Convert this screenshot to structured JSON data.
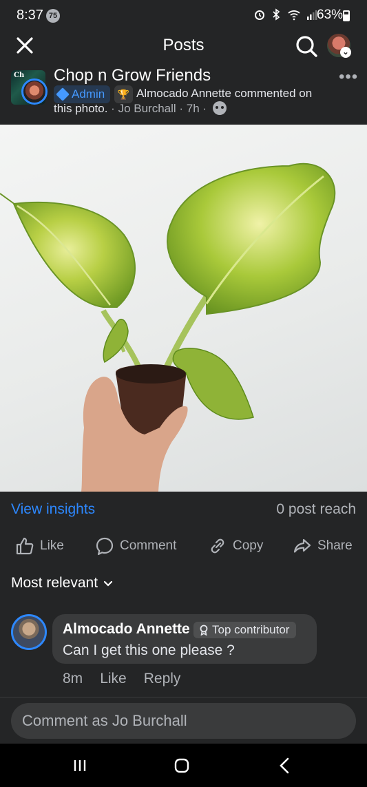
{
  "status_bar": {
    "time": "8:37",
    "notification_count": "75",
    "battery": "63%"
  },
  "header": {
    "title": "Posts",
    "icons": [
      "close-icon",
      "search-icon",
      "profile-avatar"
    ]
  },
  "post": {
    "group_name": "Chop n Grow Friends",
    "group_avatar_text": "Ch",
    "admin_badge": "Admin",
    "activity": "Almocado Annette commented on",
    "activity_cont": "this photo.",
    "separator": " · ",
    "author": "Jo Burchall",
    "time": "7h",
    "privacy_icon": "group-privacy-icon"
  },
  "insights": {
    "view_label": "View insights",
    "reach": "0 post reach"
  },
  "actions": {
    "like": "Like",
    "comment": "Comment",
    "copy": "Copy",
    "share": "Share"
  },
  "comments": {
    "sort_label": "Most relevant",
    "items": [
      {
        "name": "Almocado Annette",
        "badge": "Top contributor",
        "text": "Can I get this one please ?",
        "time": "8m",
        "like": "Like",
        "reply": "Reply"
      }
    ]
  },
  "composer": {
    "placeholder": "Comment as Jo Burchall"
  },
  "colors": {
    "background": "#242526",
    "accent": "#2d88ff",
    "bubble": "#3a3b3c",
    "muted_text": "#b0b3b8"
  }
}
